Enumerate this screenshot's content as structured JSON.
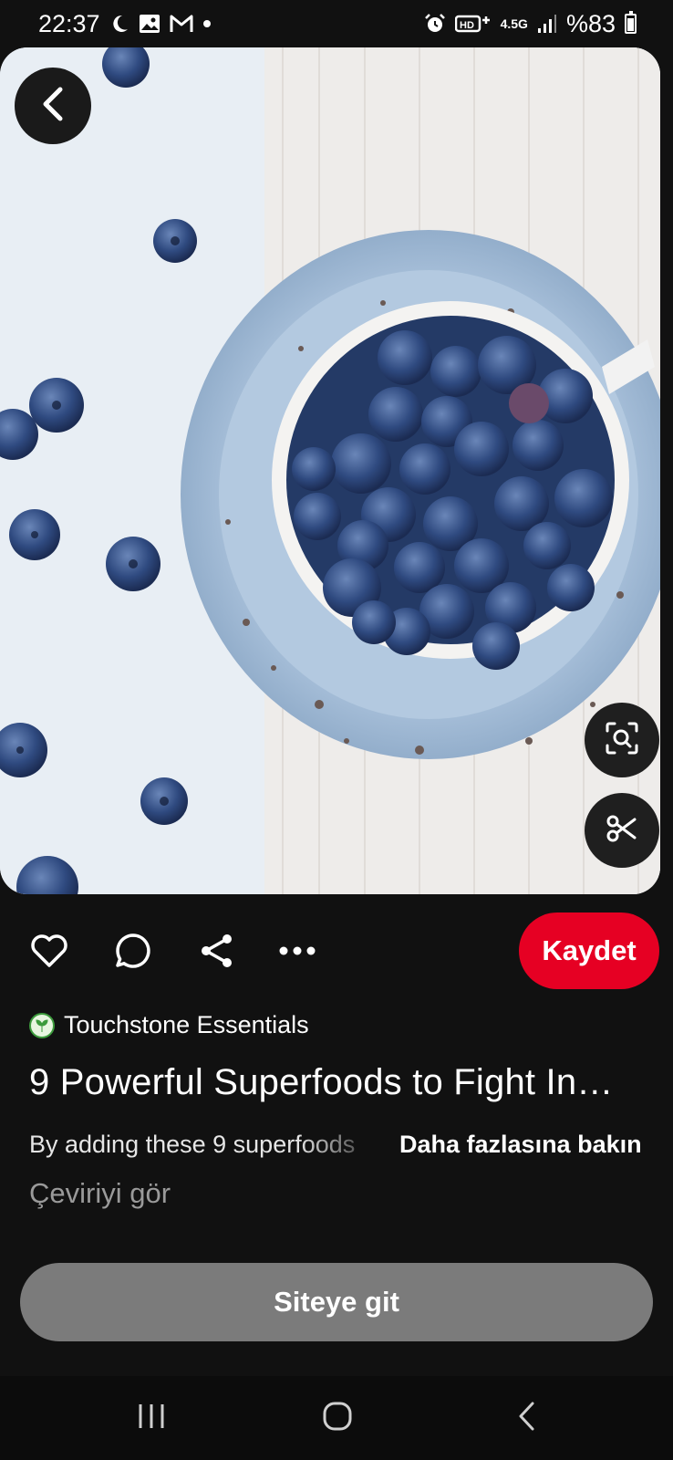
{
  "status_bar": {
    "time": "22:37",
    "left_icons": [
      "moon-icon",
      "gallery-icon",
      "gmail-icon",
      "dot-icon"
    ],
    "network": "4.5G",
    "battery": "%83",
    "right_icons": [
      "alarm-icon",
      "hd-plus-icon",
      "signal-icon",
      "battery-icon"
    ]
  },
  "pin": {
    "image_description_icon": "blueberries-photo",
    "buttons": {
      "back_icon": "chevron-left-icon",
      "lens_icon": "visual-search-icon",
      "cutout_icon": "scissors-icon"
    }
  },
  "actions": {
    "icons": [
      "heart-icon",
      "comment-icon",
      "share-icon",
      "more-icon"
    ],
    "save_label": "Kaydet",
    "save_color": "#e60023"
  },
  "author": {
    "name": "Touchstone Essentials"
  },
  "content": {
    "title": "9 Powerful Superfoods to Fight In…",
    "description": "By adding these 9 superfoods",
    "more_label": "Daha fazlasına bakın",
    "translate_label": "Çeviriyi gör"
  },
  "visit": {
    "label": "Siteye git"
  },
  "nav": {
    "icons": [
      "recent-apps-icon",
      "home-icon",
      "back-icon"
    ]
  }
}
